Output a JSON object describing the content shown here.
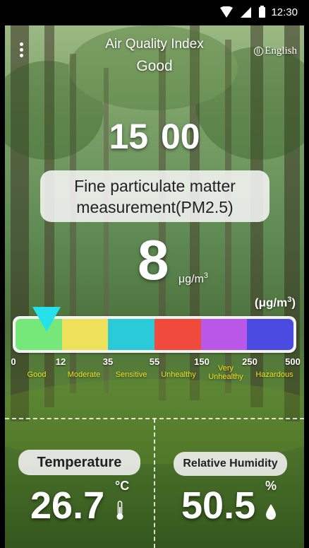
{
  "status_bar": {
    "time": "12:30"
  },
  "header": {
    "title": "Air Quality Index",
    "level": "Good",
    "language": "English"
  },
  "clock": {
    "time": "15  00"
  },
  "pollutant": {
    "line1": "Fine particulate matter",
    "line2": "measurement(PM2.5)"
  },
  "reading": {
    "value": "8",
    "unit_prefix": "μg/m",
    "unit_sup": "3"
  },
  "scale": {
    "unit_prefix": "(μg/m",
    "unit_sup": "3",
    "unit_suffix": ")",
    "ticks": [
      "0",
      "12",
      "35",
      "55",
      "150",
      "250",
      "500"
    ],
    "categories": [
      {
        "label": "Good",
        "color": "#76e879"
      },
      {
        "label": "Moderate",
        "color": "#eee05b"
      },
      {
        "label": "Sensitive",
        "color": "#2bcad9"
      },
      {
        "label": "Unhealthy",
        "color": "#f04a3c"
      },
      {
        "label_line1": "Very",
        "label_line2": "Unhealthy",
        "color": "#b957e8"
      },
      {
        "label": "Hazardous",
        "color": "#4b4be2"
      }
    ],
    "marker_color": "#25e1e9"
  },
  "temperature": {
    "label": "Temperature",
    "value": "26.7",
    "unit": "°C"
  },
  "humidity": {
    "label": "Relative Humidity",
    "value": "50.5",
    "unit": "%"
  }
}
